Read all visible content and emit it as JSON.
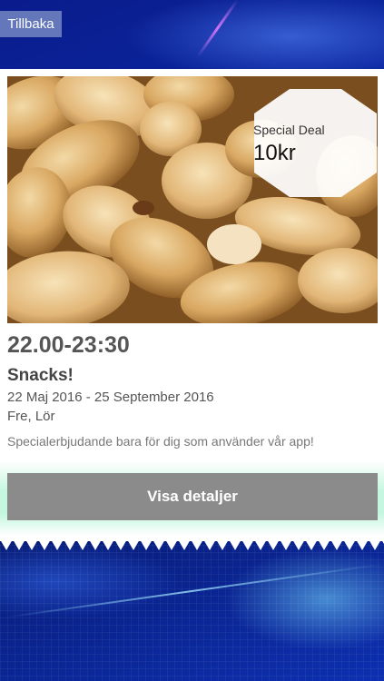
{
  "nav": {
    "back_label": "Tillbaka"
  },
  "offer": {
    "image": "salted-peanuts-photo",
    "badge": {
      "label": "Special Deal",
      "price": "10kr"
    },
    "time": "22.00-23:30",
    "title": "Snacks!",
    "date_range": "22 Maj 2016 - 25 September 2016",
    "days": "Fre, Lör",
    "description": "Specialerbjudande bara för dig som använder vår app!",
    "details_label": "Visa detaljer"
  },
  "colors": {
    "background": "#0b2aa8",
    "card": "#ffffff",
    "button": "#8b8b8b",
    "button_glow": "#bef5dc"
  }
}
